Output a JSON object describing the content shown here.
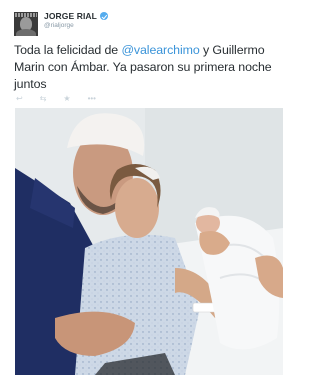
{
  "tweet": {
    "author": {
      "display_name": "JORGE RIAL",
      "handle": "@rialjorge",
      "avatar": "avatar-photo",
      "verified_icon": "verified-badge-icon"
    },
    "text": {
      "part1": "Toda la felicidad de ",
      "mention": "@valearchimo",
      "part2": " y Guillermo Marin con Ámbar. Ya pasaron su primera noche juntos"
    },
    "actions": [
      {
        "icon": "reply-icon",
        "glyph": "↩"
      },
      {
        "icon": "retweet-icon",
        "glyph": "⇆"
      },
      {
        "icon": "favorite-icon",
        "glyph": "★"
      },
      {
        "icon": "more-icon",
        "glyph": "•••"
      }
    ],
    "photo": {
      "subject": "hospital-photo"
    }
  },
  "colors": {
    "link": "#3b94d9",
    "verified": "#55acee",
    "text": "#292f33",
    "muted": "#8899a6"
  }
}
